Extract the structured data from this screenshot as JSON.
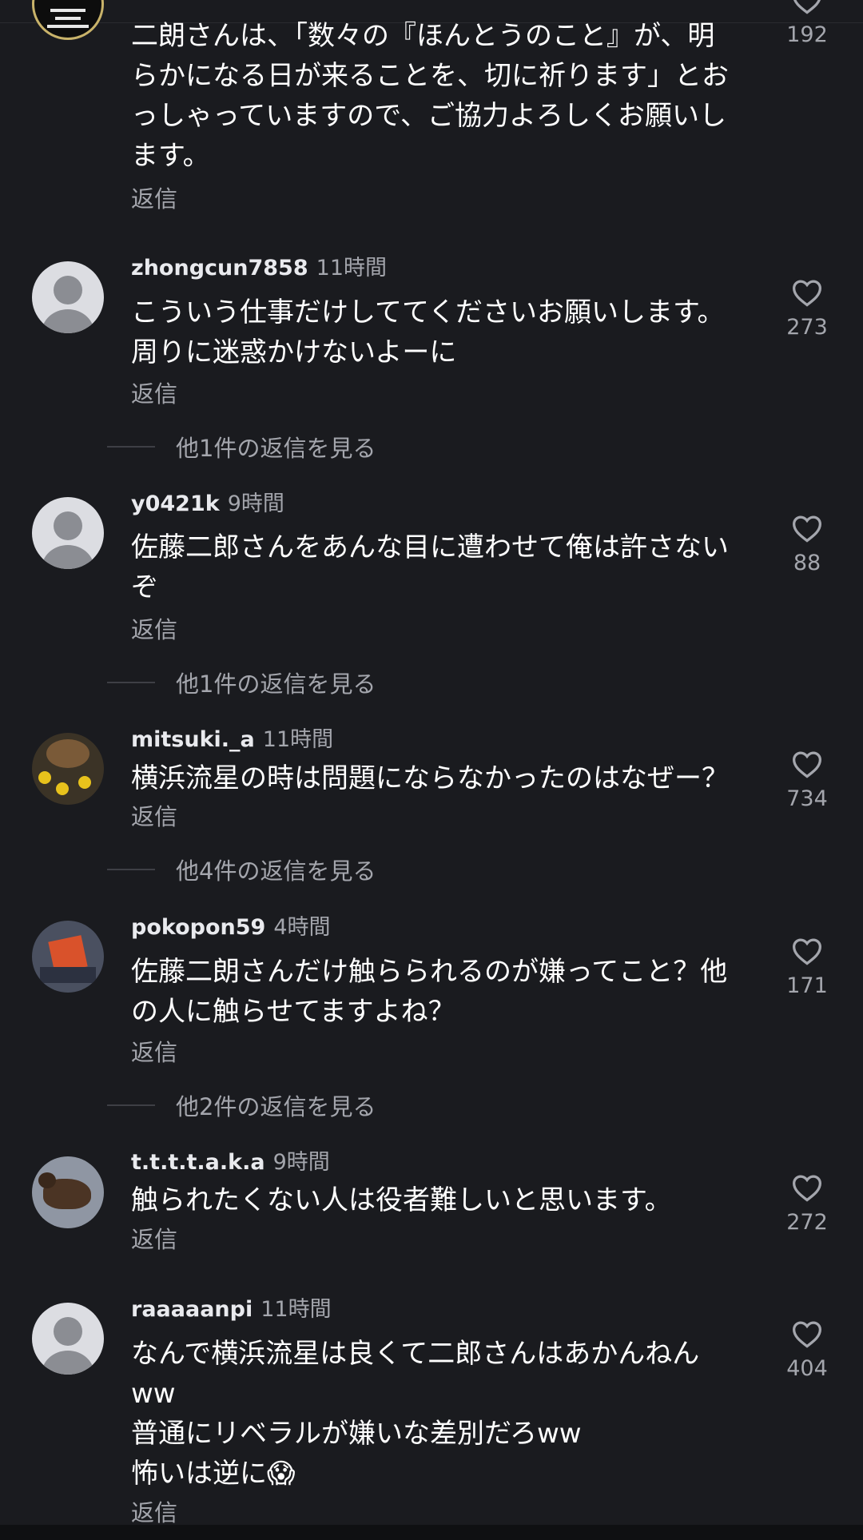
{
  "comments": [
    {
      "text": "二朗さんは、「数々の『ほんとうのこと』が、明\nらかになる日が来ることを、切に祈ります」とお\nっしゃっていますので、ご協力よろしくお願いし\nます。",
      "reply": "返信",
      "likes": "192"
    },
    {
      "username": "zhongcun7858",
      "time": "11時間",
      "text": "こういう仕事だけしててくださいお願いします。\n周りに迷惑かけないよーに",
      "reply": "返信",
      "likes": "273",
      "more_replies": "他1件の返信を見る"
    },
    {
      "username": "y0421k",
      "time": "9時間",
      "text": "佐藤二郎さんをあんな目に遭わせて俺は許さない\nぞ",
      "reply": "返信",
      "likes": "88",
      "more_replies": "他1件の返信を見る"
    },
    {
      "username": "mitsuki._a",
      "time": "11時間",
      "text": "横浜流星の時は問題にならなかったのはなぜー？",
      "reply": "返信",
      "likes": "734",
      "more_replies": "他4件の返信を見る"
    },
    {
      "username": "pokopon59",
      "time": "4時間",
      "text": "佐藤二朗さんだけ触らられるのが嫌ってこと？他\nの人に触らせてますよね？",
      "reply": "返信",
      "likes": "171",
      "more_replies": "他2件の返信を見る"
    },
    {
      "username": "t.t.t.t.a.k.a",
      "time": "9時間",
      "text": "触られたくない人は役者難しいと思います。",
      "reply": "返信",
      "likes": "272"
    },
    {
      "username": "raaaaanpi",
      "time": "11時間",
      "text": "なんで横浜流星は良くて二郎さんはあかんねん\nww\n普通にリベラルが嫌いな差別だろww\n怖いは逆に😱",
      "reply": "返信",
      "likes": "404"
    }
  ],
  "colors": {
    "background": "#1a1b1f",
    "text": "#ffffff",
    "muted": "#a4a6ad"
  },
  "icons": [
    "heart-icon",
    "default-avatar-icon"
  ]
}
